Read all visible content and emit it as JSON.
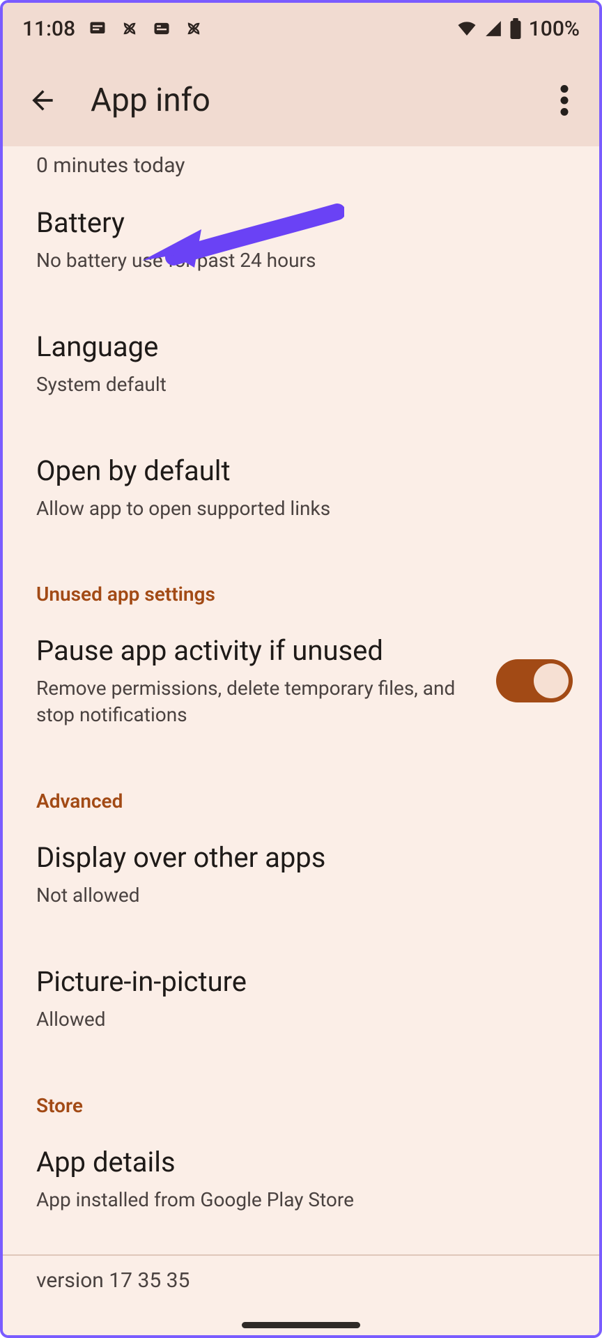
{
  "status": {
    "time": "11:08",
    "battery_text": "100%"
  },
  "header": {
    "title": "App info"
  },
  "partial_item_sub": "0 minutes today",
  "items": {
    "battery": {
      "title": "Battery",
      "sub": "No battery use for past 24 hours"
    },
    "language": {
      "title": "Language",
      "sub": "System default"
    },
    "open_default": {
      "title": "Open by default",
      "sub": "Allow app to open supported links"
    }
  },
  "sections": {
    "unused": "Unused app settings",
    "advanced": "Advanced",
    "store": "Store"
  },
  "pause": {
    "title": "Pause app activity if unused",
    "sub": "Remove permissions, delete temporary files, and stop notifications",
    "on": true
  },
  "display_over": {
    "title": "Display over other apps",
    "sub": "Not allowed"
  },
  "pip": {
    "title": "Picture-in-picture",
    "sub": "Allowed"
  },
  "app_details": {
    "title": "App details",
    "sub": "App installed from Google Play Store"
  },
  "version_partial": "version 17 35 35"
}
